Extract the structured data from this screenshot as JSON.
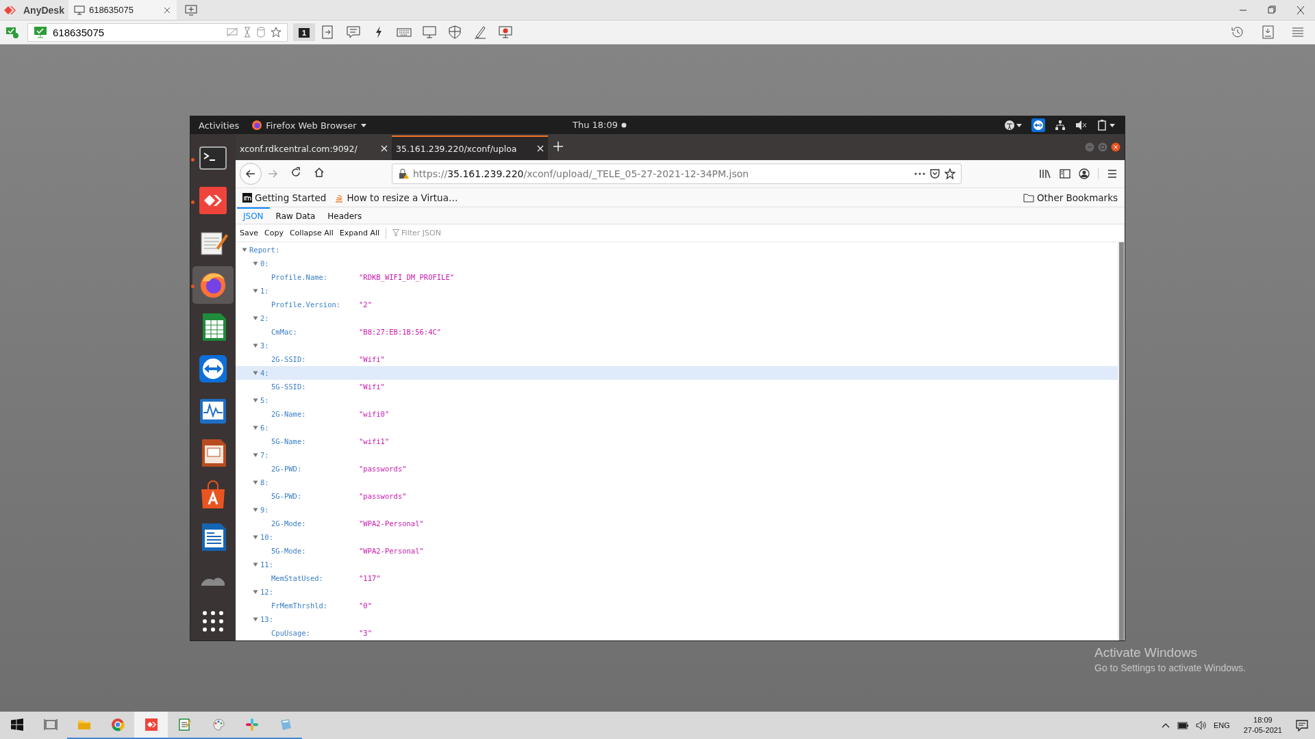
{
  "anydesk": {
    "app_name": "AnyDesk",
    "tab_title": "618635075",
    "address": "618635075",
    "monitor_number": "1"
  },
  "ubuntu_bar": {
    "activities": "Activities",
    "app_menu": "Firefox Web Browser",
    "clock": "Thu 18:09"
  },
  "dock": {
    "items": [
      {
        "kind": "terminal",
        "running": true,
        "selected": false
      },
      {
        "kind": "anydesk",
        "running": true,
        "selected": false
      },
      {
        "kind": "editor",
        "running": false,
        "selected": false
      },
      {
        "kind": "firefox",
        "running": true,
        "selected": true
      },
      {
        "kind": "calc",
        "running": false,
        "selected": false
      },
      {
        "kind": "teamviewer",
        "running": false,
        "selected": false
      },
      {
        "kind": "monitor",
        "running": false,
        "selected": false
      },
      {
        "kind": "impress",
        "running": false,
        "selected": false
      },
      {
        "kind": "store",
        "running": false,
        "selected": false
      },
      {
        "kind": "writer",
        "running": false,
        "selected": false
      },
      {
        "kind": "misc",
        "running": false,
        "selected": false
      },
      {
        "kind": "apps",
        "running": false,
        "selected": false
      }
    ]
  },
  "browser": {
    "tabs": [
      {
        "title": "xconf.rdkcentral.com:9092/",
        "selected": false
      },
      {
        "title": "35.161.239.220/xconf/uploa",
        "selected": true
      }
    ],
    "url": "https://**35.161.239.220**/xconf/upload/_TELE_05-27-2021-12-34PM.json",
    "bookmarks": [
      {
        "kind": "m",
        "label": "Getting Started"
      },
      {
        "kind": "stack",
        "label": "How to resize a Virtua…"
      }
    ],
    "other_bookmarks": "Other Bookmarks",
    "viewer_tabs": [
      {
        "label": "JSON",
        "selected": true
      },
      {
        "label": "Raw Data",
        "selected": false
      },
      {
        "label": "Headers",
        "selected": false
      }
    ],
    "toolbar": [
      "Save",
      "Copy",
      "Collapse All",
      "Expand All"
    ],
    "filter": {
      "placeholder": "Filter JSON"
    },
    "tree": {
      "key": "Report:",
      "expanded": true,
      "children": [
        {
          "key": "0:",
          "expanded": true,
          "selected": false,
          "children": [
            {
              "key": "Profile.Name:",
              "value": "\"RDKB_WIFI_DM_PROFILE\""
            }
          ]
        },
        {
          "key": "1:",
          "expanded": true,
          "selected": false,
          "children": [
            {
              "key": "Profile.Version:",
              "value": "\"2\""
            }
          ]
        },
        {
          "key": "2:",
          "expanded": true,
          "selected": false,
          "children": [
            {
              "key": "CmMac:",
              "value": "\"B8:27:EB:1B:56:4C\""
            }
          ]
        },
        {
          "key": "3:",
          "expanded": true,
          "selected": false,
          "children": [
            {
              "key": "2G-SSID:",
              "value": "\"Wifi\""
            }
          ]
        },
        {
          "key": "4:",
          "expanded": true,
          "selected": true,
          "children": [
            {
              "key": "5G-SSID:",
              "value": "\"Wifi\""
            }
          ]
        },
        {
          "key": "5:",
          "expanded": true,
          "selected": false,
          "children": [
            {
              "key": "2G-Name:",
              "value": "\"wifi0\""
            }
          ]
        },
        {
          "key": "6:",
          "expanded": true,
          "selected": false,
          "children": [
            {
              "key": "5G-Name:",
              "value": "\"wifi1\""
            }
          ]
        },
        {
          "key": "7:",
          "expanded": true,
          "selected": false,
          "children": [
            {
              "key": "2G-PWD:",
              "value": "\"passwords\""
            }
          ]
        },
        {
          "key": "8:",
          "expanded": true,
          "selected": false,
          "children": [
            {
              "key": "5G-PWD:",
              "value": "\"passwords\""
            }
          ]
        },
        {
          "key": "9:",
          "expanded": true,
          "selected": false,
          "children": [
            {
              "key": "2G-Mode:",
              "value": "\"WPA2-Personal\""
            }
          ]
        },
        {
          "key": "10:",
          "expanded": true,
          "selected": false,
          "children": [
            {
              "key": "5G-Mode:",
              "value": "\"WPA2-Personal\""
            }
          ]
        },
        {
          "key": "11:",
          "expanded": true,
          "selected": false,
          "children": [
            {
              "key": "MemStatUsed:",
              "value": "\"117\""
            }
          ]
        },
        {
          "key": "12:",
          "expanded": true,
          "selected": false,
          "children": [
            {
              "key": "FrMemThrshld:",
              "value": "\"0\""
            }
          ]
        },
        {
          "key": "13:",
          "expanded": true,
          "selected": false,
          "children": [
            {
              "key": "CpuUsage:",
              "value": "\"3\""
            }
          ]
        }
      ]
    }
  },
  "taskbar": {
    "apps": [
      {
        "kind": "taskview",
        "active": false
      },
      {
        "kind": "explorer",
        "active": true
      },
      {
        "kind": "chrome",
        "active": true
      },
      {
        "kind": "anydesk",
        "active": true
      },
      {
        "kind": "notepad",
        "active": true
      },
      {
        "kind": "paint",
        "active": true
      },
      {
        "kind": "slack",
        "active": true
      },
      {
        "kind": "tool",
        "active": true
      }
    ],
    "language": "ENG",
    "time": "18:09",
    "date": "27-05-2021"
  },
  "activation": {
    "title": "Activate Windows",
    "subtitle": "Go to Settings to activate Windows."
  }
}
